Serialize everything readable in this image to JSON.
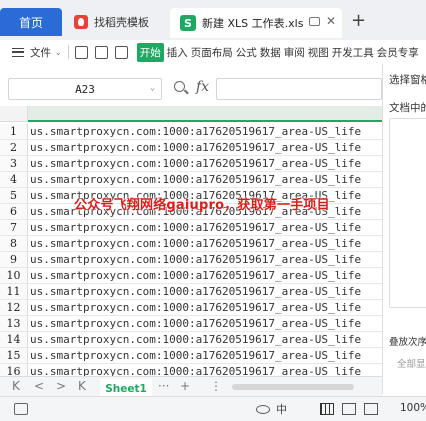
{
  "tabs": {
    "home": "首页",
    "template": "找稻壳模板",
    "file": "新建 XLS 工作表.xls",
    "add": "+"
  },
  "menu": {
    "file": "文件",
    "items": [
      "开始",
      "插入",
      "页面布局",
      "公式",
      "数据",
      "审阅",
      "视图",
      "开发工具",
      "会员专享"
    ]
  },
  "formula": {
    "cell_ref": "A23",
    "fx": "fx",
    "value": ""
  },
  "sheet": {
    "row_numbers": [
      "1",
      "2",
      "3",
      "4",
      "5",
      "6",
      "7",
      "8",
      "9",
      "10",
      "11",
      "12",
      "13",
      "14",
      "15",
      "16"
    ],
    "cells": [
      "us.smartproxycn.com:1000:a17620519617_area-US_life",
      "us.smartproxycn.com:1000:a17620519617_area-US_life",
      "us.smartproxycn.com:1000:a17620519617_area-US_life",
      "us.smartproxycn.com:1000:a17620519617_area-US_life",
      "us.smartproxycn.com:1000:a17620519617_area-US_life",
      "us.smartproxycn.com:1000:a17620519617_area-US_life",
      "us.smartproxycn.com:1000:a17620519617_area-US_life",
      "us.smartproxycn.com:1000:a17620519617_area-US_life",
      "us.smartproxycn.com:1000:a17620519617_area-US_life",
      "us.smartproxycn.com:1000:a17620519617_area-US_life",
      "us.smartproxycn.com:1000:a17620519617_area-US_life",
      "us.smartproxycn.com:1000:a17620519617_area-US_life",
      "us.smartproxycn.com:1000:a17620519617_area-US_life",
      "us.smartproxycn.com:1000:a17620519617_area-US_life",
      "us.smartproxycn.com:1000:a17620519617_area-US_life",
      "us.smartproxycn.com:1000:a17620519617_area-US_life"
    ],
    "watermark": "公众号飞翔网络gaiupro，获取第一手项目"
  },
  "side_panel": {
    "title": "选择窗格",
    "doc": "文档中的",
    "order": "叠放次序",
    "all": "全部显"
  },
  "sheet_tabs": {
    "first": "K",
    "prev": "<",
    "next": ">",
    "last": "K",
    "active": "Sheet1",
    "more": "···",
    "add": "+"
  },
  "status": {
    "lang": "中",
    "zoom": "100%"
  },
  "colors": {
    "accent": "#1ea963",
    "home_tab": "#2a6bd8",
    "watermark": "#d91e18"
  }
}
